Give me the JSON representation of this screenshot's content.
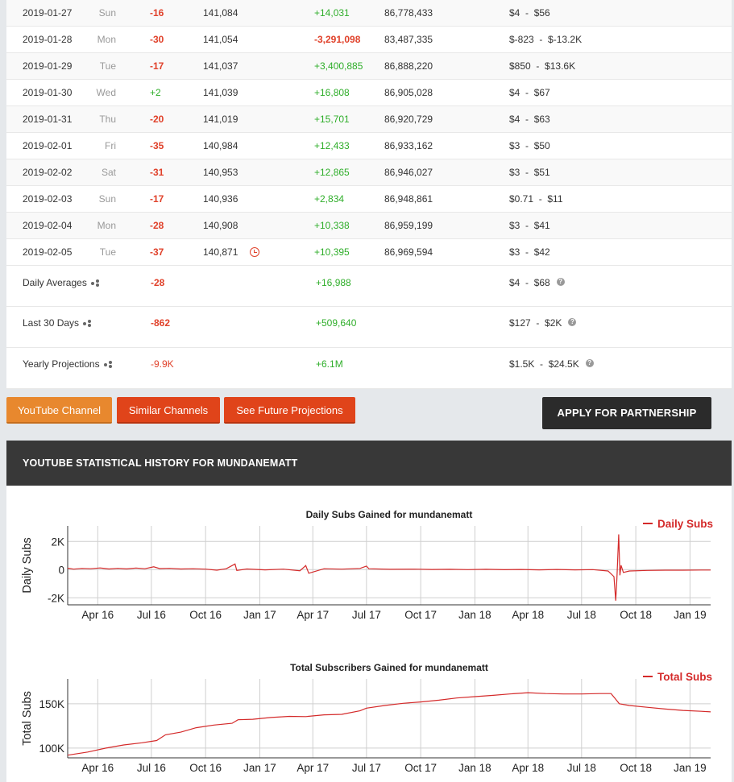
{
  "rows": [
    {
      "date": "2019-01-27",
      "day": "Sun",
      "dsub": "-16",
      "subs": "141,084",
      "dview": "+14,031",
      "views": "86,778,433",
      "earn_lo": "$4",
      "earn_hi": "$56",
      "dview_neg": false,
      "dsub_pos": false
    },
    {
      "date": "2019-01-28",
      "day": "Mon",
      "dsub": "-30",
      "subs": "141,054",
      "dview": "-3,291,098",
      "views": "83,487,335",
      "earn_lo": "$-823",
      "earn_hi": "$-13.2K",
      "dview_neg": true,
      "dsub_pos": false
    },
    {
      "date": "2019-01-29",
      "day": "Tue",
      "dsub": "-17",
      "subs": "141,037",
      "dview": "+3,400,885",
      "views": "86,888,220",
      "earn_lo": "$850",
      "earn_hi": "$13.6K",
      "dview_neg": false,
      "dsub_pos": false
    },
    {
      "date": "2019-01-30",
      "day": "Wed",
      "dsub": "+2",
      "subs": "141,039",
      "dview": "+16,808",
      "views": "86,905,028",
      "earn_lo": "$4",
      "earn_hi": "$67",
      "dview_neg": false,
      "dsub_pos": true
    },
    {
      "date": "2019-01-31",
      "day": "Thu",
      "dsub": "-20",
      "subs": "141,019",
      "dview": "+15,701",
      "views": "86,920,729",
      "earn_lo": "$4",
      "earn_hi": "$63",
      "dview_neg": false,
      "dsub_pos": false
    },
    {
      "date": "2019-02-01",
      "day": "Fri",
      "dsub": "-35",
      "subs": "140,984",
      "dview": "+12,433",
      "views": "86,933,162",
      "earn_lo": "$3",
      "earn_hi": "$50",
      "dview_neg": false,
      "dsub_pos": false
    },
    {
      "date": "2019-02-02",
      "day": "Sat",
      "dsub": "-31",
      "subs": "140,953",
      "dview": "+12,865",
      "views": "86,946,027",
      "earn_lo": "$3",
      "earn_hi": "$51",
      "dview_neg": false,
      "dsub_pos": false
    },
    {
      "date": "2019-02-03",
      "day": "Sun",
      "dsub": "-17",
      "subs": "140,936",
      "dview": "+2,834",
      "views": "86,948,861",
      "earn_lo": "$0.71",
      "earn_hi": "$11",
      "dview_neg": false,
      "dsub_pos": false
    },
    {
      "date": "2019-02-04",
      "day": "Mon",
      "dsub": "-28",
      "subs": "140,908",
      "dview": "+10,338",
      "views": "86,959,199",
      "earn_lo": "$3",
      "earn_hi": "$41",
      "dview_neg": false,
      "dsub_pos": false
    },
    {
      "date": "2019-02-05",
      "day": "Tue",
      "dsub": "-37",
      "subs": "140,871",
      "dview": "+10,395",
      "views": "86,969,594",
      "earn_lo": "$3",
      "earn_hi": "$42",
      "dview_neg": false,
      "dsub_pos": false,
      "has_clock": true
    }
  ],
  "summary": [
    {
      "label": "Daily Averages",
      "dsub": "-28",
      "dview": "+16,988",
      "earn_lo": "$4",
      "earn_hi": "$68"
    },
    {
      "label": "Last 30 Days",
      "dsub": "-862",
      "dview": "+509,640",
      "earn_lo": "$127",
      "earn_hi": "$2K"
    },
    {
      "label": "Yearly Projections",
      "dsub": "-9.9K",
      "dview": "+6.1M",
      "earn_lo": "$1.5K",
      "earn_hi": "$24.5K"
    }
  ],
  "buttons": {
    "youtube_channel": "YouTube Channel",
    "similar_channels": "Similar Channels",
    "future_projections": "See Future Projections",
    "apply_partnership": "APPLY FOR PARTNERSHIP"
  },
  "history_title": "YOUTUBE STATISTICAL HISTORY FOR MUNDANEMATT",
  "colors": {
    "accent_red": "#e0412a",
    "positive_green": "#2fae2a",
    "line_red": "#d42a2a"
  },
  "chart_data": [
    {
      "type": "line",
      "title": "Daily Subs Gained for mundanematt",
      "ylabel": "Daily Subs",
      "xlabel": "",
      "legend": "top-right",
      "x_ticks": [
        "Apr 16",
        "Jul 16",
        "Oct 16",
        "Jan 17",
        "Apr 17",
        "Jul 17",
        "Oct 17",
        "Jan 18",
        "Apr 18",
        "Jul 18",
        "Oct 18",
        "Jan 19"
      ],
      "y_ticks": [
        {
          "v": 2000,
          "label": "2K"
        },
        {
          "v": 0,
          "label": "0"
        },
        {
          "v": -2000,
          "label": "-2K"
        }
      ],
      "ylim": [
        -2500,
        3100
      ],
      "xlim": [
        "2016-02-10",
        "2019-02-05"
      ],
      "series": [
        {
          "name": "Daily Subs",
          "points": [
            [
              "2016-02-10",
              100
            ],
            [
              "2016-02-20",
              30
            ],
            [
              "2016-03-05",
              80
            ],
            [
              "2016-03-20",
              60
            ],
            [
              "2016-04-05",
              120
            ],
            [
              "2016-04-20",
              40
            ],
            [
              "2016-05-05",
              90
            ],
            [
              "2016-05-20",
              50
            ],
            [
              "2016-06-05",
              110
            ],
            [
              "2016-06-20",
              60
            ],
            [
              "2016-07-05",
              200
            ],
            [
              "2016-07-15",
              70
            ],
            [
              "2016-08-01",
              90
            ],
            [
              "2016-08-20",
              40
            ],
            [
              "2016-09-10",
              60
            ],
            [
              "2016-10-01",
              30
            ],
            [
              "2016-10-20",
              -40
            ],
            [
              "2016-11-05",
              60
            ],
            [
              "2016-11-20",
              400
            ],
            [
              "2016-11-23",
              -60
            ],
            [
              "2016-12-10",
              40
            ],
            [
              "2017-01-10",
              -20
            ],
            [
              "2017-02-10",
              30
            ],
            [
              "2017-03-10",
              -80
            ],
            [
              "2017-03-20",
              280
            ],
            [
              "2017-03-25",
              -260
            ],
            [
              "2017-04-20",
              60
            ],
            [
              "2017-05-20",
              30
            ],
            [
              "2017-06-20",
              80
            ],
            [
              "2017-07-01",
              250
            ],
            [
              "2017-07-05",
              60
            ],
            [
              "2017-08-10",
              20
            ],
            [
              "2017-09-20",
              30
            ],
            [
              "2017-10-20",
              10
            ],
            [
              "2017-11-20",
              20
            ],
            [
              "2017-12-20",
              0
            ],
            [
              "2018-01-20",
              20
            ],
            [
              "2018-02-20",
              -10
            ],
            [
              "2018-03-20",
              10
            ],
            [
              "2018-04-20",
              -20
            ],
            [
              "2018-05-20",
              10
            ],
            [
              "2018-06-20",
              -20
            ],
            [
              "2018-07-20",
              0
            ],
            [
              "2018-08-15",
              -100
            ],
            [
              "2018-08-25",
              -500
            ],
            [
              "2018-08-28",
              -2200
            ],
            [
              "2018-08-30",
              -600
            ],
            [
              "2018-09-02",
              2500
            ],
            [
              "2018-09-04",
              -400
            ],
            [
              "2018-09-06",
              300
            ],
            [
              "2018-09-10",
              -200
            ],
            [
              "2018-09-20",
              -100
            ],
            [
              "2018-10-20",
              -60
            ],
            [
              "2018-11-20",
              -40
            ],
            [
              "2018-12-20",
              -40
            ],
            [
              "2019-01-20",
              -30
            ],
            [
              "2019-02-05",
              -30
            ]
          ]
        }
      ]
    },
    {
      "type": "line",
      "title": "Total Subscribers Gained for mundanematt",
      "ylabel": "Total Subs",
      "xlabel": "",
      "legend": "top-right",
      "x_ticks": [
        "Apr 16",
        "Jul 16",
        "Oct 16",
        "Jan 17",
        "Apr 17",
        "Jul 17",
        "Oct 17",
        "Jan 18",
        "Apr 18",
        "Jul 18",
        "Oct 18",
        "Jan 19"
      ],
      "y_ticks": [
        {
          "v": 150000,
          "label": "150K"
        },
        {
          "v": 100000,
          "label": "100K"
        }
      ],
      "ylim": [
        89000,
        178000
      ],
      "xlim": [
        "2016-02-10",
        "2019-02-05"
      ],
      "series": [
        {
          "name": "Total Subs",
          "points": [
            [
              "2016-02-10",
              92000
            ],
            [
              "2016-03-15",
              95500
            ],
            [
              "2016-04-15",
              100000
            ],
            [
              "2016-05-15",
              103500
            ],
            [
              "2016-06-15",
              106000
            ],
            [
              "2016-07-10",
              108500
            ],
            [
              "2016-07-25",
              115000
            ],
            [
              "2016-08-20",
              118000
            ],
            [
              "2016-09-15",
              123000
            ],
            [
              "2016-10-15",
              126000
            ],
            [
              "2016-11-15",
              128000
            ],
            [
              "2016-11-25",
              132000
            ],
            [
              "2016-12-20",
              132500
            ],
            [
              "2017-01-20",
              134500
            ],
            [
              "2017-02-20",
              135800
            ],
            [
              "2017-03-20",
              135500
            ],
            [
              "2017-04-20",
              137500
            ],
            [
              "2017-05-20",
              138000
            ],
            [
              "2017-06-20",
              142000
            ],
            [
              "2017-07-01",
              145000
            ],
            [
              "2017-08-01",
              148000
            ],
            [
              "2017-09-01",
              150500
            ],
            [
              "2017-10-01",
              152000
            ],
            [
              "2017-11-01",
              154000
            ],
            [
              "2017-12-01",
              156500
            ],
            [
              "2018-01-01",
              158000
            ],
            [
              "2018-02-01",
              159500
            ],
            [
              "2018-03-01",
              161000
            ],
            [
              "2018-04-01",
              162500
            ],
            [
              "2018-05-01",
              161500
            ],
            [
              "2018-06-01",
              161000
            ],
            [
              "2018-07-01",
              161000
            ],
            [
              "2018-08-01",
              161500
            ],
            [
              "2018-08-20",
              161500
            ],
            [
              "2018-08-28",
              155000
            ],
            [
              "2018-09-03",
              150000
            ],
            [
              "2018-09-20",
              148000
            ],
            [
              "2018-10-20",
              146000
            ],
            [
              "2018-11-20",
              144000
            ],
            [
              "2018-12-20",
              142500
            ],
            [
              "2019-01-20",
              141500
            ],
            [
              "2019-02-05",
              140871
            ]
          ]
        }
      ]
    }
  ]
}
